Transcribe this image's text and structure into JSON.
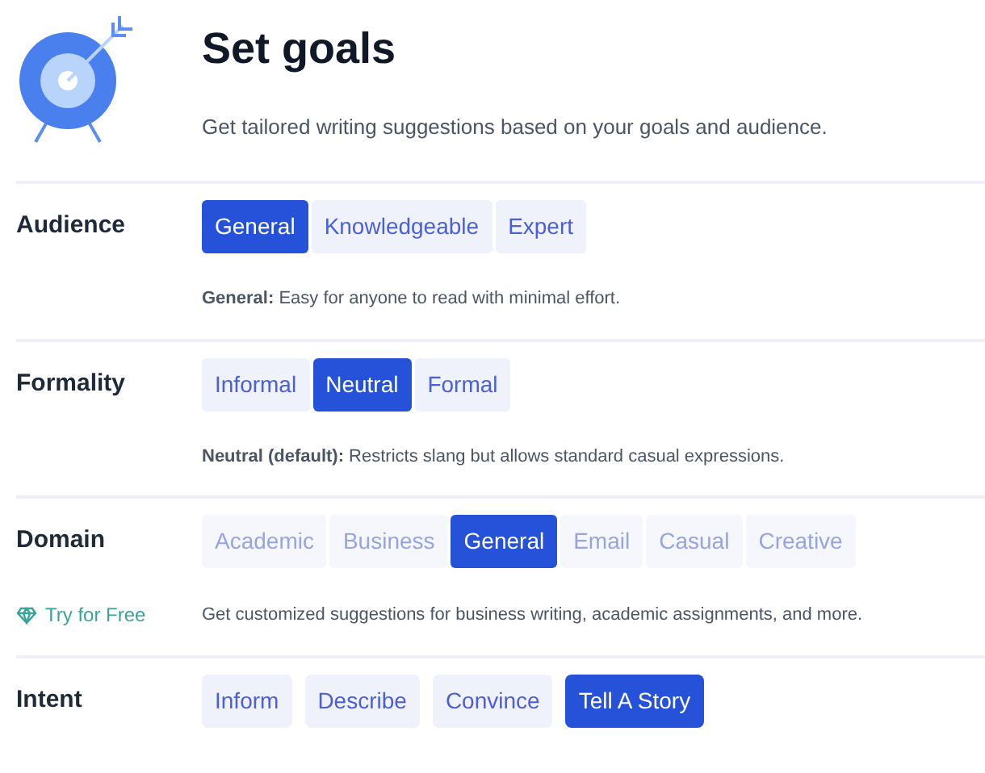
{
  "header": {
    "title": "Set goals",
    "subtitle": "Get tailored writing suggestions based on your goals and audience."
  },
  "sections": [
    {
      "label": "Audience",
      "grouped": true,
      "options": [
        {
          "label": "General",
          "selected": true,
          "disabled": false
        },
        {
          "label": "Knowledgeable",
          "selected": false,
          "disabled": false
        },
        {
          "label": "Expert",
          "selected": false,
          "disabled": false
        }
      ],
      "description": "**General:** Easy for anyone to read with minimal effort."
    },
    {
      "label": "Formality",
      "grouped": true,
      "options": [
        {
          "label": "Informal",
          "selected": false,
          "disabled": false
        },
        {
          "label": "Neutral",
          "selected": true,
          "disabled": false
        },
        {
          "label": "Formal",
          "selected": false,
          "disabled": false
        }
      ],
      "description": "**Neutral (default):** Restricts slang but allows standard casual expressions."
    },
    {
      "label": "Domain",
      "grouped": true,
      "promo": "Try for Free",
      "options": [
        {
          "label": "Academic",
          "selected": false,
          "disabled": true
        },
        {
          "label": "Business",
          "selected": false,
          "disabled": true
        },
        {
          "label": "General",
          "selected": true,
          "disabled": false
        },
        {
          "label": "Email",
          "selected": false,
          "disabled": true
        },
        {
          "label": "Casual",
          "selected": false,
          "disabled": true
        },
        {
          "label": "Creative",
          "selected": false,
          "disabled": true
        }
      ],
      "description": "Get customized suggestions for business writing, academic assignments, and more."
    },
    {
      "label": "Intent",
      "grouped": false,
      "options": [
        {
          "label": "Inform",
          "selected": false,
          "disabled": false
        },
        {
          "label": "Describe",
          "selected": false,
          "disabled": false
        },
        {
          "label": "Convince",
          "selected": false,
          "disabled": false
        },
        {
          "label": "Tell A Story",
          "selected": true,
          "disabled": false
        }
      ]
    }
  ]
}
